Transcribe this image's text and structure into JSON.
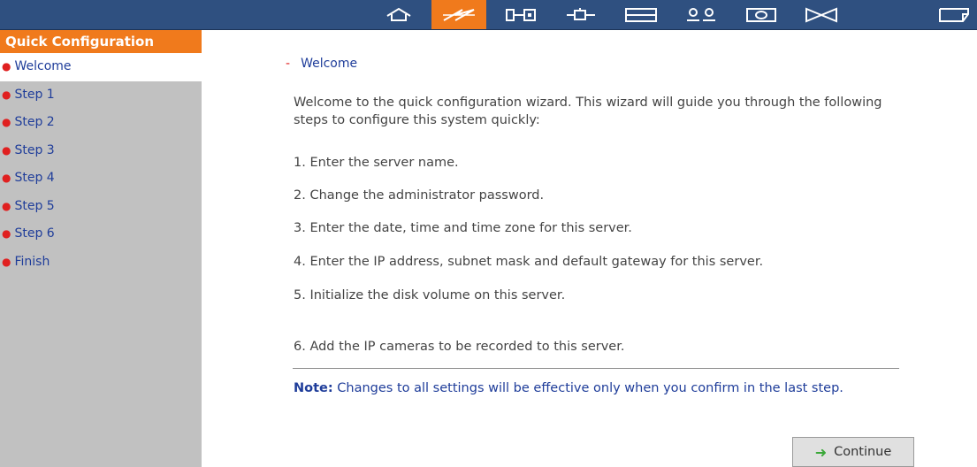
{
  "topnav": {
    "tabs": [
      {
        "icon": "home-icon",
        "active": false
      },
      {
        "icon": "quick-config-icon",
        "active": true
      },
      {
        "icon": "network-icon",
        "active": false
      },
      {
        "icon": "device-config-icon",
        "active": false
      },
      {
        "icon": "disk-icon",
        "active": false
      },
      {
        "icon": "users-icon",
        "active": false
      },
      {
        "icon": "camera-icon",
        "active": false
      },
      {
        "icon": "tools-icon",
        "active": false
      },
      {
        "icon": "logs-icon",
        "active": false
      }
    ]
  },
  "sidebar": {
    "title": "Quick Configuration",
    "items": [
      {
        "label": "Welcome",
        "active": true
      },
      {
        "label": "Step 1",
        "active": false
      },
      {
        "label": "Step 2",
        "active": false
      },
      {
        "label": "Step 3",
        "active": false
      },
      {
        "label": "Step 4",
        "active": false
      },
      {
        "label": "Step 5",
        "active": false
      },
      {
        "label": "Step 6",
        "active": false
      },
      {
        "label": "Finish",
        "active": false
      }
    ]
  },
  "main": {
    "heading_dash": "-",
    "heading": "Welcome",
    "intro": "Welcome to the quick configuration wizard. This wizard will guide you through the following steps to configure this system quickly:",
    "steps": [
      "1. Enter the server name.",
      "2. Change the administrator password.",
      "3. Enter the date, time and time zone for this server.",
      "4. Enter the IP address, subnet mask and default gateway for this server.",
      "5. Initialize the disk volume on this server.",
      "6. Add the IP cameras to be recorded to this server."
    ],
    "note_label": "Note:",
    "note_text": " Changes to all settings will be effective only when you confirm in the last step.",
    "continue_label": "Continue"
  },
  "colors": {
    "topbar": "#2f5080",
    "accent": "#f07a1c",
    "sidebar_bg": "#c1c1c1",
    "link": "#1f3d9a",
    "bullet": "#e02020"
  }
}
